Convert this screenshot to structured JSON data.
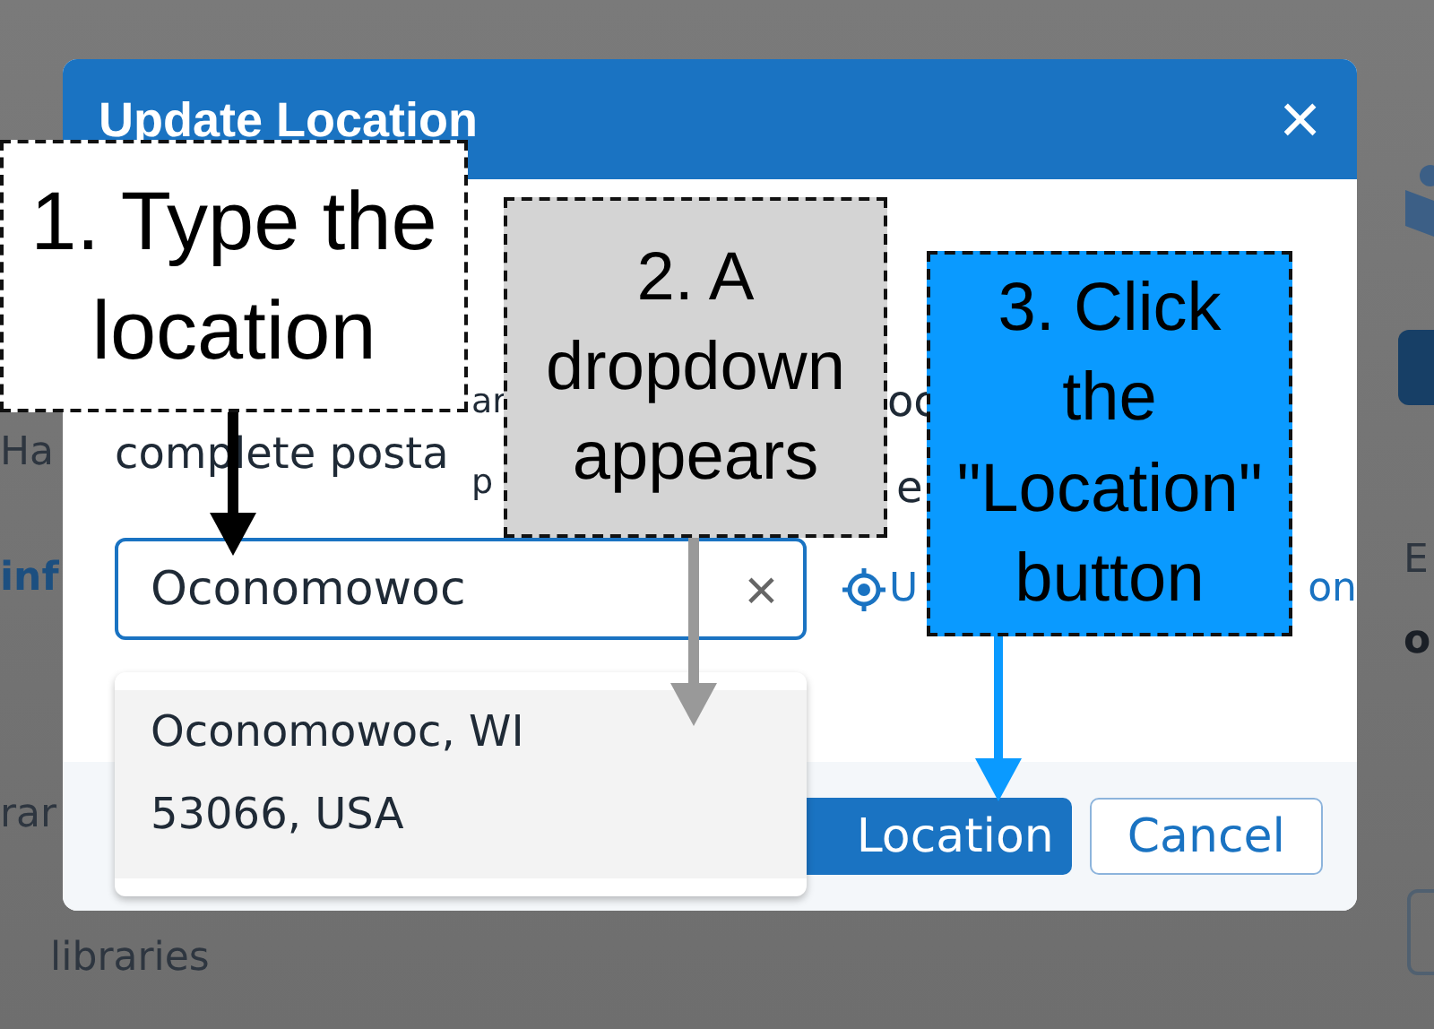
{
  "background": {
    "left_texts": [
      {
        "text": "Ha",
        "kind": "plain"
      },
      {
        "text": "inf",
        "kind": "link"
      },
      {
        "text": "rar",
        "kind": "plain"
      },
      {
        "text": "libraries",
        "kind": "plain"
      }
    ],
    "right_texts": [
      {
        "text": "E",
        "kind": "plain"
      },
      {
        "text": "o",
        "kind": "bold"
      }
    ]
  },
  "dialog": {
    "title": "Update Location",
    "close": "×",
    "body_fragments": [
      "ar",
      "oc",
      "p",
      "e"
    ],
    "body_line": "complete posta",
    "search": {
      "value": "Oconomowoc",
      "clear": "×"
    },
    "link_fragments": [
      "U",
      "on"
    ],
    "suggestions": [
      {
        "text": "Oconomowoc, WI 53066, USA",
        "selected": true
      }
    ],
    "buttons": [
      {
        "label": "Location",
        "kind": "primary"
      },
      {
        "label": "Cancel",
        "kind": "secondary"
      }
    ]
  },
  "callouts": [
    {
      "text": "1. Type the location",
      "color": "#ffffff"
    },
    {
      "text": "2. A dropdown appears",
      "color": "#d4d4d4"
    },
    {
      "text": "3. Click the \"Location\" button",
      "color": "#0a9aff"
    }
  ]
}
